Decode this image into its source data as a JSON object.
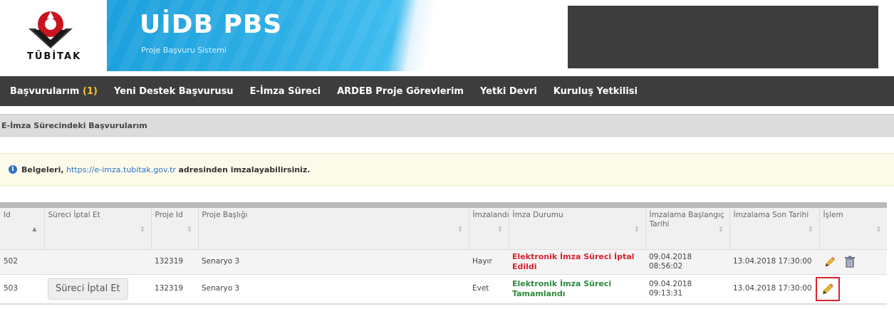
{
  "header": {
    "logo_text": "TÜBİTAK",
    "brand_title": "UİDB PBS",
    "brand_subtitle": "Proje Başvuru Sistemi"
  },
  "nav": {
    "items": [
      {
        "label": "Başvurularım",
        "count": "(1)"
      },
      {
        "label": "Yeni Destek Başvurusu"
      },
      {
        "label": "E-İmza Süreci"
      },
      {
        "label": "ARDEB Proje Görevlerim"
      },
      {
        "label": "Yetki Devri"
      },
      {
        "label": "Kuruluş Yetkilisi"
      }
    ]
  },
  "panel": {
    "title": "E-İmza Sürecindeki Başvurularım"
  },
  "notice": {
    "prefix": "Belgeleri,",
    "link": "https://e-imza.tubitak.gov.tr",
    "suffix": "adresinden imzalayabilirsiniz."
  },
  "table": {
    "headers": {
      "id": "Id",
      "cancel": "Süreci İptal Et",
      "project_id": "Proje Id",
      "project_title": "Proje Başlığı",
      "signed": "İmzalandı",
      "status": "İmza Durumu",
      "start": "İmzalama Başlangıç Tarihi",
      "end": "İmzalama Son Tarihi",
      "action": "İşlem"
    },
    "rows": [
      {
        "id": "502",
        "cancel_label": "",
        "project_id": "132319",
        "project_title": "Senaryo 3",
        "signed": "Hayır",
        "status": "Elektronik İmza Süreci İptal Edildi",
        "start": "09.04.2018 08:56:02",
        "end": "13.04.2018 17:30:00"
      },
      {
        "id": "503",
        "cancel_label": "Süreci İptal Et",
        "project_id": "132319",
        "project_title": "Senaryo 3",
        "signed": "Evet",
        "status": "Elektronik İmza Süreci Tamamlandı",
        "start": "09.04.2018 09:13:31",
        "end": "13.04.2018 17:30:00"
      }
    ]
  },
  "colors": {
    "nav_bg": "#3d3d3d",
    "banner_blue": "#1ca0dc",
    "status_cancelled": "#d7232d",
    "status_completed": "#2c8a3c",
    "highlight": "#d8252b"
  }
}
